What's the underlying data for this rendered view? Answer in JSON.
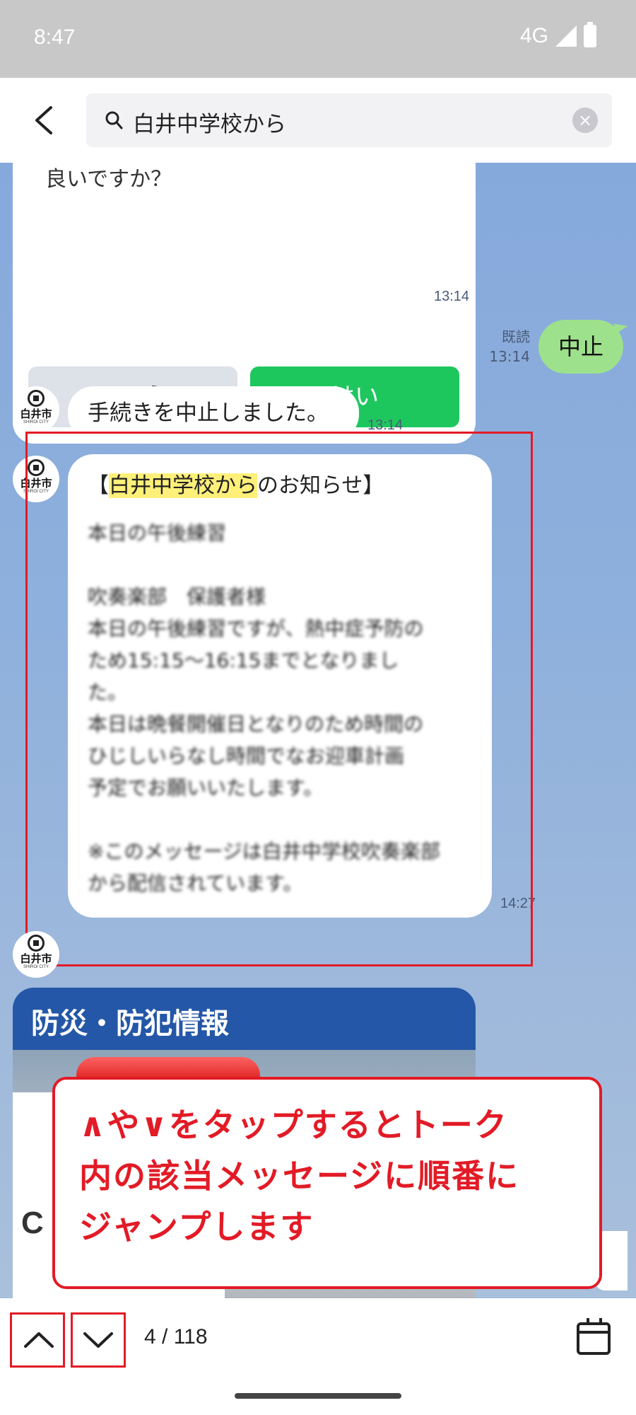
{
  "status_bar": {
    "time": "8:47",
    "network": "4G"
  },
  "search": {
    "query": "白井中学校から"
  },
  "chat": {
    "card": {
      "partial_text": "良いですか？",
      "no_label": "いいえ",
      "yes_label": "はい",
      "time": "13:14"
    },
    "sent": {
      "read_label": "既読",
      "time": "13:14",
      "text": "中止"
    },
    "avatar": {
      "name": "白井市",
      "sub": "SHIROI CITY"
    },
    "msg1": {
      "text": "手続きを中止しました。",
      "time": "13:14"
    },
    "msg2": {
      "title_open": "【",
      "title_highlight": "白井中学校から",
      "title_rest": "のお知らせ】",
      "lines": [
        "本日の午後練習",
        "",
        "吹奏楽部　保護者様",
        "本日の午後練習ですが、熱中症予防の",
        "ため15:15～16:15までとなりまし",
        "た。",
        "本日は晩餐開催日となりのため時間の",
        "ひじしいらなし時間でなお迎車計画",
        "予定でお願いいたします。",
        "",
        "※このメッセージは白井中学校吹奏楽部",
        "から配信されています。"
      ],
      "time": "14:27"
    },
    "banner": {
      "title": "防災・防犯情報",
      "photo_text": "CE"
    },
    "callout": {
      "line1": "∧や∨をタップするとトーク",
      "line2": "内の該当メッセージに順番に",
      "line3": "ジャンプします"
    }
  },
  "bottom_bar": {
    "counter": "4 / 118"
  }
}
